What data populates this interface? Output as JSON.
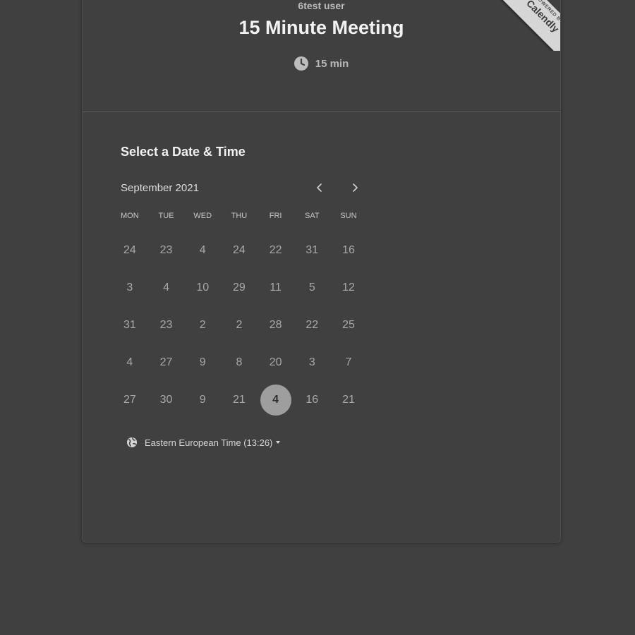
{
  "header": {
    "user_name": "6test user",
    "event_title": "15 Minute Meeting",
    "duration": "15 min"
  },
  "ribbon": {
    "small_text": "POWERED BY",
    "brand": "Calendly"
  },
  "calendar": {
    "section_title": "Select a Date & Time",
    "month_label": "September 2021",
    "weekdays": [
      "MON",
      "TUE",
      "WED",
      "THU",
      "FRI",
      "SAT",
      "SUN"
    ],
    "days": [
      [
        "24",
        "23",
        "4",
        "24",
        "22",
        "31",
        "16"
      ],
      [
        "3",
        "4",
        "10",
        "29",
        "11",
        "5",
        "12"
      ],
      [
        "31",
        "23",
        "2",
        "2",
        "28",
        "22",
        "25"
      ],
      [
        "4",
        "27",
        "9",
        "8",
        "20",
        "3",
        "7"
      ],
      [
        "27",
        "30",
        "9",
        "21",
        "4",
        "16",
        "21"
      ]
    ],
    "selected_day": "4"
  },
  "timezone": {
    "label": "Eastern European Time (13:26)"
  },
  "icons": {
    "clock": "clock-icon",
    "globe": "globe-icon",
    "prev": "chevron-left-icon",
    "next": "chevron-right-icon",
    "caret": "caret-down-icon"
  }
}
